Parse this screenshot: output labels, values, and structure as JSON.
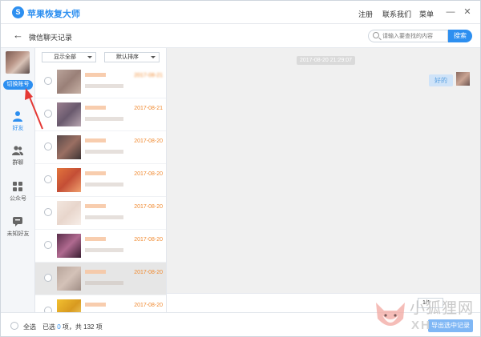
{
  "app": {
    "title": "苹果恢复大师",
    "logo_glyph": "S"
  },
  "titlebar": {
    "links": [
      "注册",
      "联系我们",
      "菜单"
    ]
  },
  "header": {
    "page_title": "微信聊天记录",
    "search_placeholder": "请输入要查找的内容",
    "search_button": "搜索"
  },
  "sidebar": {
    "switch_button": "切换账号",
    "items": [
      {
        "label": "好友",
        "icon": "person-icon",
        "active": true
      },
      {
        "label": "群聊",
        "icon": "group-icon",
        "active": false
      },
      {
        "label": "公众号",
        "icon": "grid-icon",
        "active": false
      },
      {
        "label": "未知好友",
        "icon": "unknown-friend-icon",
        "active": false
      }
    ]
  },
  "list": {
    "filter_show": "显示全部",
    "filter_sort": "默认排序",
    "rows": [
      {
        "date": "2017-08-21",
        "date_blurred": true
      },
      {
        "date": "2017-08-21",
        "date_blurred": false
      },
      {
        "date": "2017-08-20",
        "date_blurred": false
      },
      {
        "date": "2017-08-20",
        "date_blurred": false
      },
      {
        "date": "2017-08-20",
        "date_blurred": false
      },
      {
        "date": "2017-08-20",
        "date_blurred": false
      },
      {
        "date": "2017-08-20",
        "date_blurred": false
      },
      {
        "date": "2017-08-20",
        "date_blurred": false
      }
    ]
  },
  "chat": {
    "timestamp": "2017-08-20 21:29:07",
    "message": "好的",
    "pager": "1/1"
  },
  "bottom": {
    "select_all": "全选",
    "selected_prefix": "已选",
    "selected_count": "0",
    "selected_mid": "项，共",
    "total_count": "132",
    "selected_suffix": "项",
    "export_button": "导出选中记录"
  },
  "watermark": {
    "text_cn": "小狐狸网",
    "text_en": "XH"
  },
  "colors": {
    "accent": "#2d8ff0",
    "date": "#f08a30",
    "annotation": "#e53935"
  }
}
